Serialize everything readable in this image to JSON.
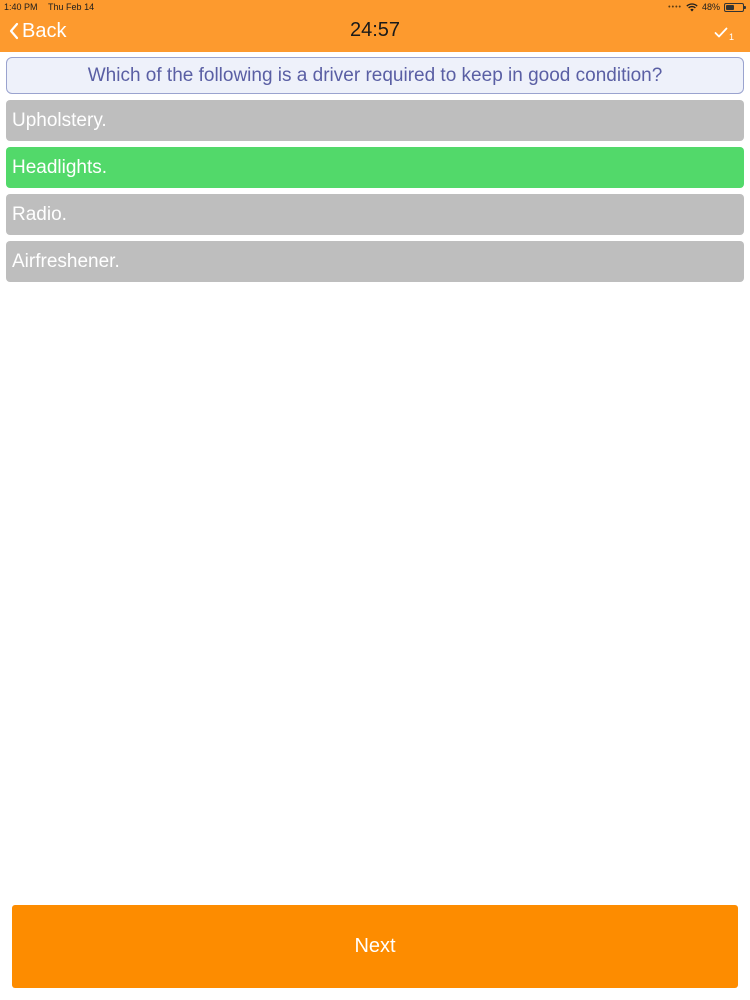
{
  "status_bar": {
    "time": "1:40 PM",
    "date": "Thu Feb 14",
    "battery": "48%"
  },
  "nav": {
    "back_label": "Back",
    "timer": "24:57",
    "answered_count": "1"
  },
  "question": {
    "text": "Which of the following is a driver required to keep in good condition?"
  },
  "answers": [
    {
      "label": "Upholstery.",
      "selected": false
    },
    {
      "label": "Headlights.",
      "selected": true
    },
    {
      "label": "Radio.",
      "selected": false
    },
    {
      "label": "Airfreshener.",
      "selected": false
    }
  ],
  "next_label": "Next",
  "colors": {
    "header": "#fd9a2e",
    "answer_default": "#bebebe",
    "answer_selected": "#52d96a",
    "next_button": "#fd8c00",
    "question_text": "#5a5fa4"
  }
}
